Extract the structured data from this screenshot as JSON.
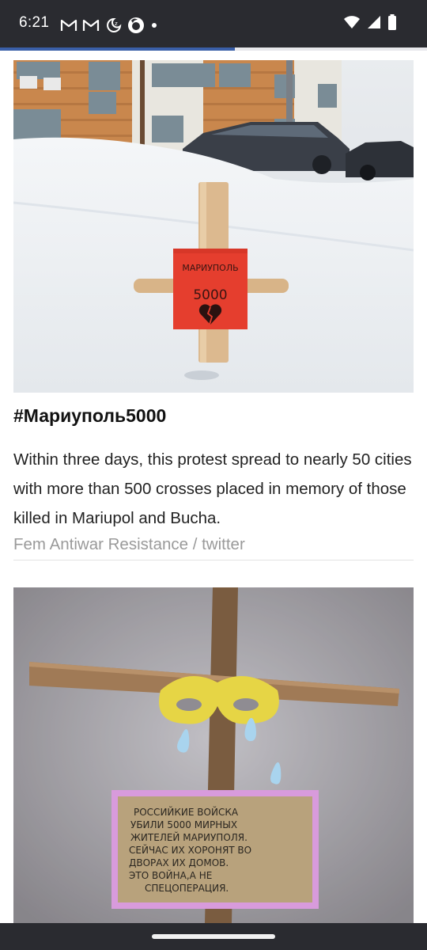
{
  "status_bar": {
    "time": "6:21",
    "left_icons": [
      "gmail-icon",
      "gmail-icon",
      "do-not-disturb-icon",
      "firefox-icon",
      "notification-dot-icon"
    ],
    "right_icons": [
      "wifi-icon",
      "cell-signal-icon",
      "battery-icon"
    ]
  },
  "reading_progress": 0.55,
  "article": {
    "photo1": {
      "sign_line1": "МАРИУПОЛЬ",
      "sign_line2": "5000"
    },
    "caption_title": "#Мариуполь5000",
    "caption_body": "Within three days, this protest spread to nearly 50 cities with more than 500 crosses placed in memory of those killed in Mariupol and Bucha.",
    "caption_credit": "Fem Antiwar Resistance / twitter",
    "photo2": {
      "sign_lines": [
        "РОССИЙКИЕ ВОЙСКА",
        "УБИЛИ 5000 МИРНЫХ",
        "ЖИТЕЛЕЙ МАРИУПОЛЯ.",
        "СЕЙЧАС ИХ ХОРОНЯТ ВО",
        "ДВОРАХ ИХ ДОМОВ.",
        "ЭТО ВОЙНА,А НЕ",
        "СПЕЦОПЕРАЦИЯ."
      ]
    }
  },
  "colors": {
    "status_bar": "#2a2b30",
    "progress": "#3a5fa8",
    "credit_text": "#9a9a9a"
  }
}
